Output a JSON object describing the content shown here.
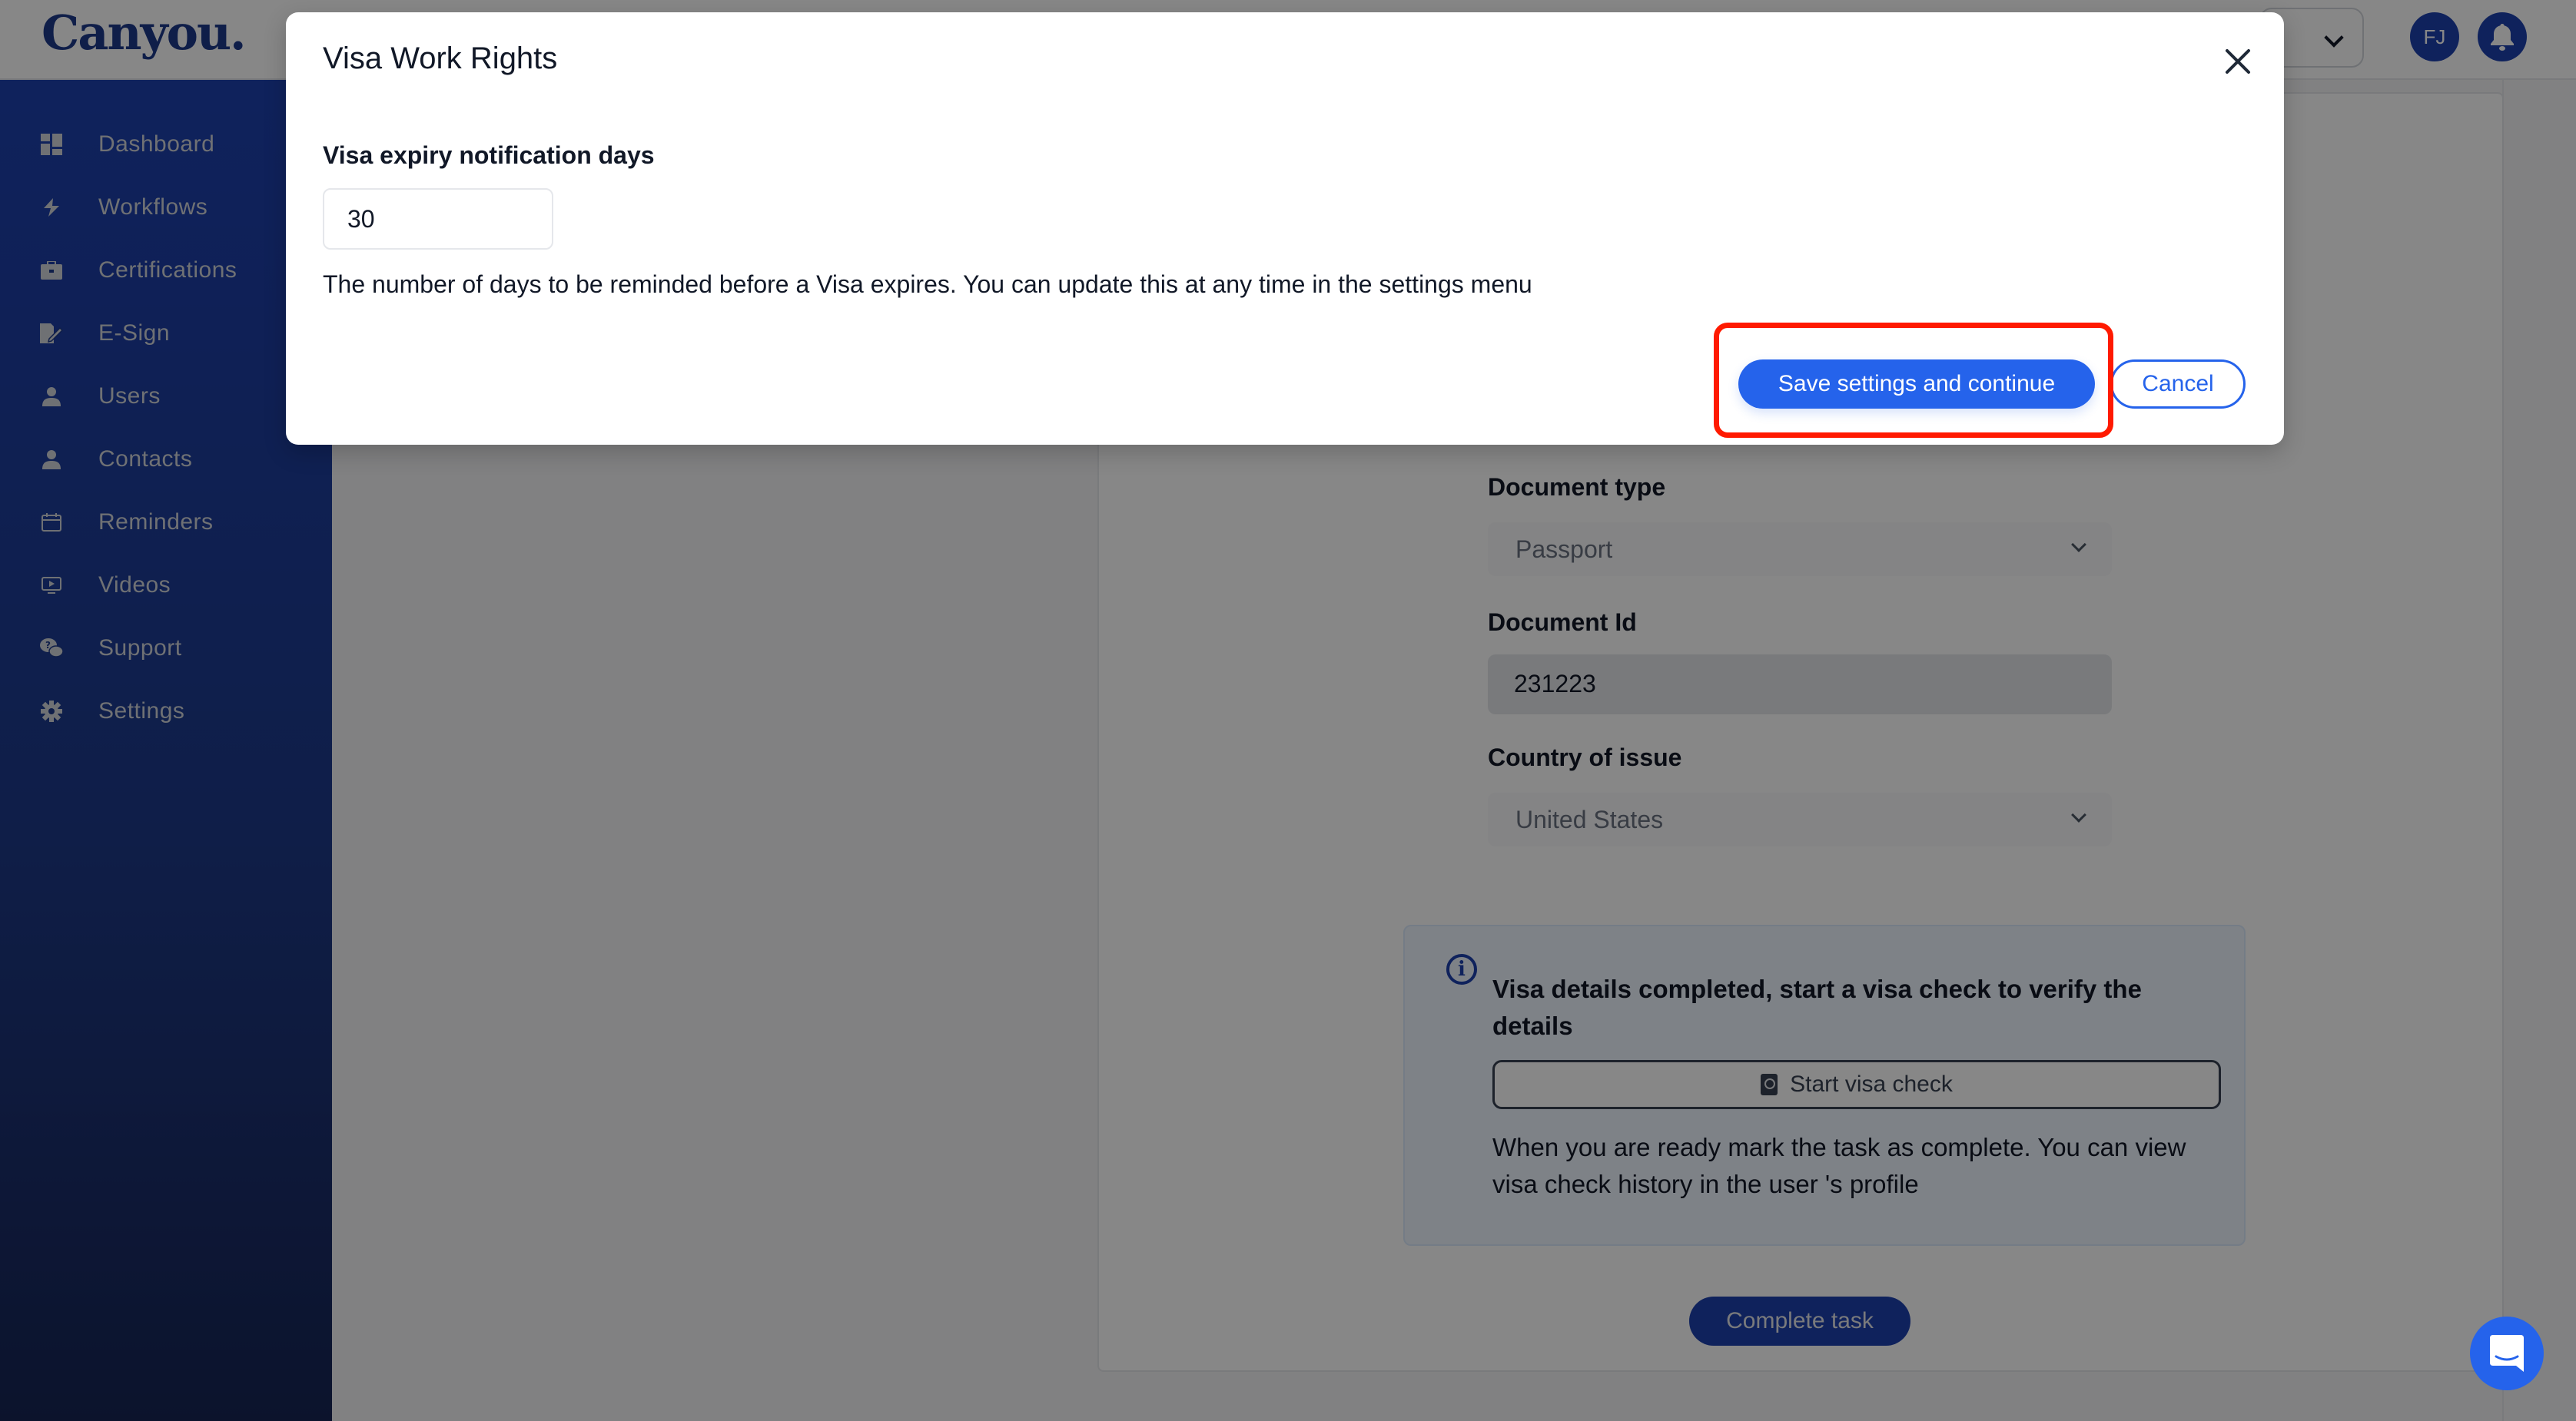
{
  "app": {
    "logo_text": "Canyou.",
    "avatar_initials": "FJ"
  },
  "sidebar": {
    "items": [
      {
        "label": "Dashboard",
        "icon": "dashboard-icon"
      },
      {
        "label": "Workflows",
        "icon": "bolt-icon"
      },
      {
        "label": "Certifications",
        "icon": "briefcase-icon"
      },
      {
        "label": "E-Sign",
        "icon": "signature-icon"
      },
      {
        "label": "Users",
        "icon": "user-icon"
      },
      {
        "label": "Contacts",
        "icon": "contact-icon"
      },
      {
        "label": "Reminders",
        "icon": "calendar-icon"
      },
      {
        "label": "Videos",
        "icon": "video-icon"
      },
      {
        "label": "Support",
        "icon": "support-chat-icon"
      },
      {
        "label": "Settings",
        "icon": "gear-icon"
      }
    ]
  },
  "form": {
    "document_type": {
      "label": "Document type",
      "value": "Passport"
    },
    "document_id": {
      "label": "Document Id",
      "value": "231223"
    },
    "country_of_issue": {
      "label": "Country of issue",
      "value": "United States"
    },
    "info": {
      "title": "Visa details completed, start a visa check to verify the details",
      "start_visa_check_label": "Start visa check",
      "text": "When you are ready mark the task as complete. You can view visa check history in the user 's profile"
    },
    "complete_task_label": "Complete task"
  },
  "modal": {
    "title": "Visa Work Rights",
    "field_label": "Visa expiry notification days",
    "field_value": "30",
    "help_text": "The number of days to be reminded before a Visa expires. You can update this at any time in the settings menu",
    "save_label": "Save settings and continue",
    "cancel_label": "Cancel"
  },
  "colors": {
    "brand": "#1e40af",
    "primary_button": "#2563eb",
    "highlight": "#ff1a00"
  }
}
